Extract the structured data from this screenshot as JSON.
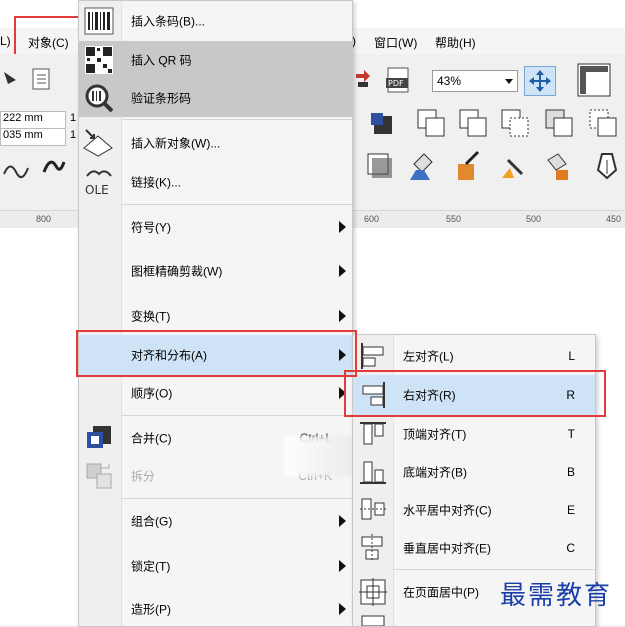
{
  "menubar": {
    "partial_left": "L)",
    "object": "对象(C)",
    "partial_mid": ")",
    "window": "窗口(W)",
    "help": "帮助(H)"
  },
  "toolbar": {
    "zoom": "43%",
    "dim1": "222 mm",
    "dim2": "035 mm",
    "dim1_right": "1",
    "dim2_right": "1"
  },
  "ruler": {
    "labels": [
      "800",
      "600",
      "550",
      "500",
      "450"
    ]
  },
  "object_menu": {
    "items": [
      {
        "label": "插入条码(B)...",
        "icon": "barcode-icon"
      },
      {
        "label": "插入 QR 码",
        "icon": "qr-code-icon"
      },
      {
        "label": "验证条形码",
        "icon": "verify-barcode-icon"
      },
      {
        "label": "插入新对象(W)...",
        "icon": "insert-object-icon"
      },
      {
        "label": "链接(K)...",
        "icon": "ole-icon"
      },
      {
        "label": "符号(Y)"
      },
      {
        "label": "图框精确剪裁(W)"
      },
      {
        "label": "变换(T)"
      },
      {
        "label": "对齐和分布(A)"
      },
      {
        "label": "顺序(O)"
      },
      {
        "label": "合并(C)",
        "shortcut": "Ctrl+L",
        "icon": "combine-icon"
      },
      {
        "label": "拆分",
        "shortcut": "Ctrl+K",
        "icon": "break-apart-icon"
      },
      {
        "label": "组合(G)"
      },
      {
        "label": "锁定(T)"
      },
      {
        "label": "造形(P)"
      }
    ]
  },
  "align_submenu": {
    "items": [
      {
        "label": "左对齐(L)",
        "shortcut": "L",
        "icon": "align-left-icon"
      },
      {
        "label": "右对齐(R)",
        "shortcut": "R",
        "icon": "align-right-icon"
      },
      {
        "label": "顶端对齐(T)",
        "shortcut": "T",
        "icon": "align-top-icon"
      },
      {
        "label": "底端对齐(B)",
        "shortcut": "B",
        "icon": "align-bottom-icon"
      },
      {
        "label": "水平居中对齐(C)",
        "shortcut": "E",
        "icon": "align-center-horizontal-icon"
      },
      {
        "label": "垂直居中对齐(E)",
        "shortcut": "C",
        "icon": "align-center-vertical-icon"
      },
      {
        "label": "在页面居中(P)",
        "shortcut": "P",
        "icon": "center-page-icon"
      }
    ]
  },
  "watermark": "最需教育",
  "colors": {
    "highlight": "#cfe3f7",
    "callout": "#e33b3b",
    "watermark": "#1a3fa8"
  }
}
